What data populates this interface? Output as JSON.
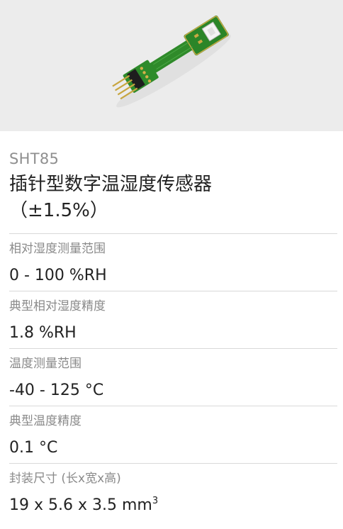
{
  "product": {
    "image_alt": "SHT85 sensor module",
    "model": "SHT85",
    "title_line1": "插针型数字温湿度传感器",
    "title_line2": "（±1.5%）"
  },
  "specs": [
    {
      "label": "相对湿度测量范围",
      "value": "0 - 100 %RH"
    },
    {
      "label": "典型相对湿度精度",
      "value": "1.8 %RH"
    },
    {
      "label": "温度测量范围",
      "value": "-40 - 125 °C"
    },
    {
      "label": "典型温度精度",
      "value": "0.1 °C"
    },
    {
      "label": "封装尺寸 (长x宽x高)",
      "value": "19 x 5.6 x 3.5 mm",
      "value_sup": "3"
    }
  ]
}
